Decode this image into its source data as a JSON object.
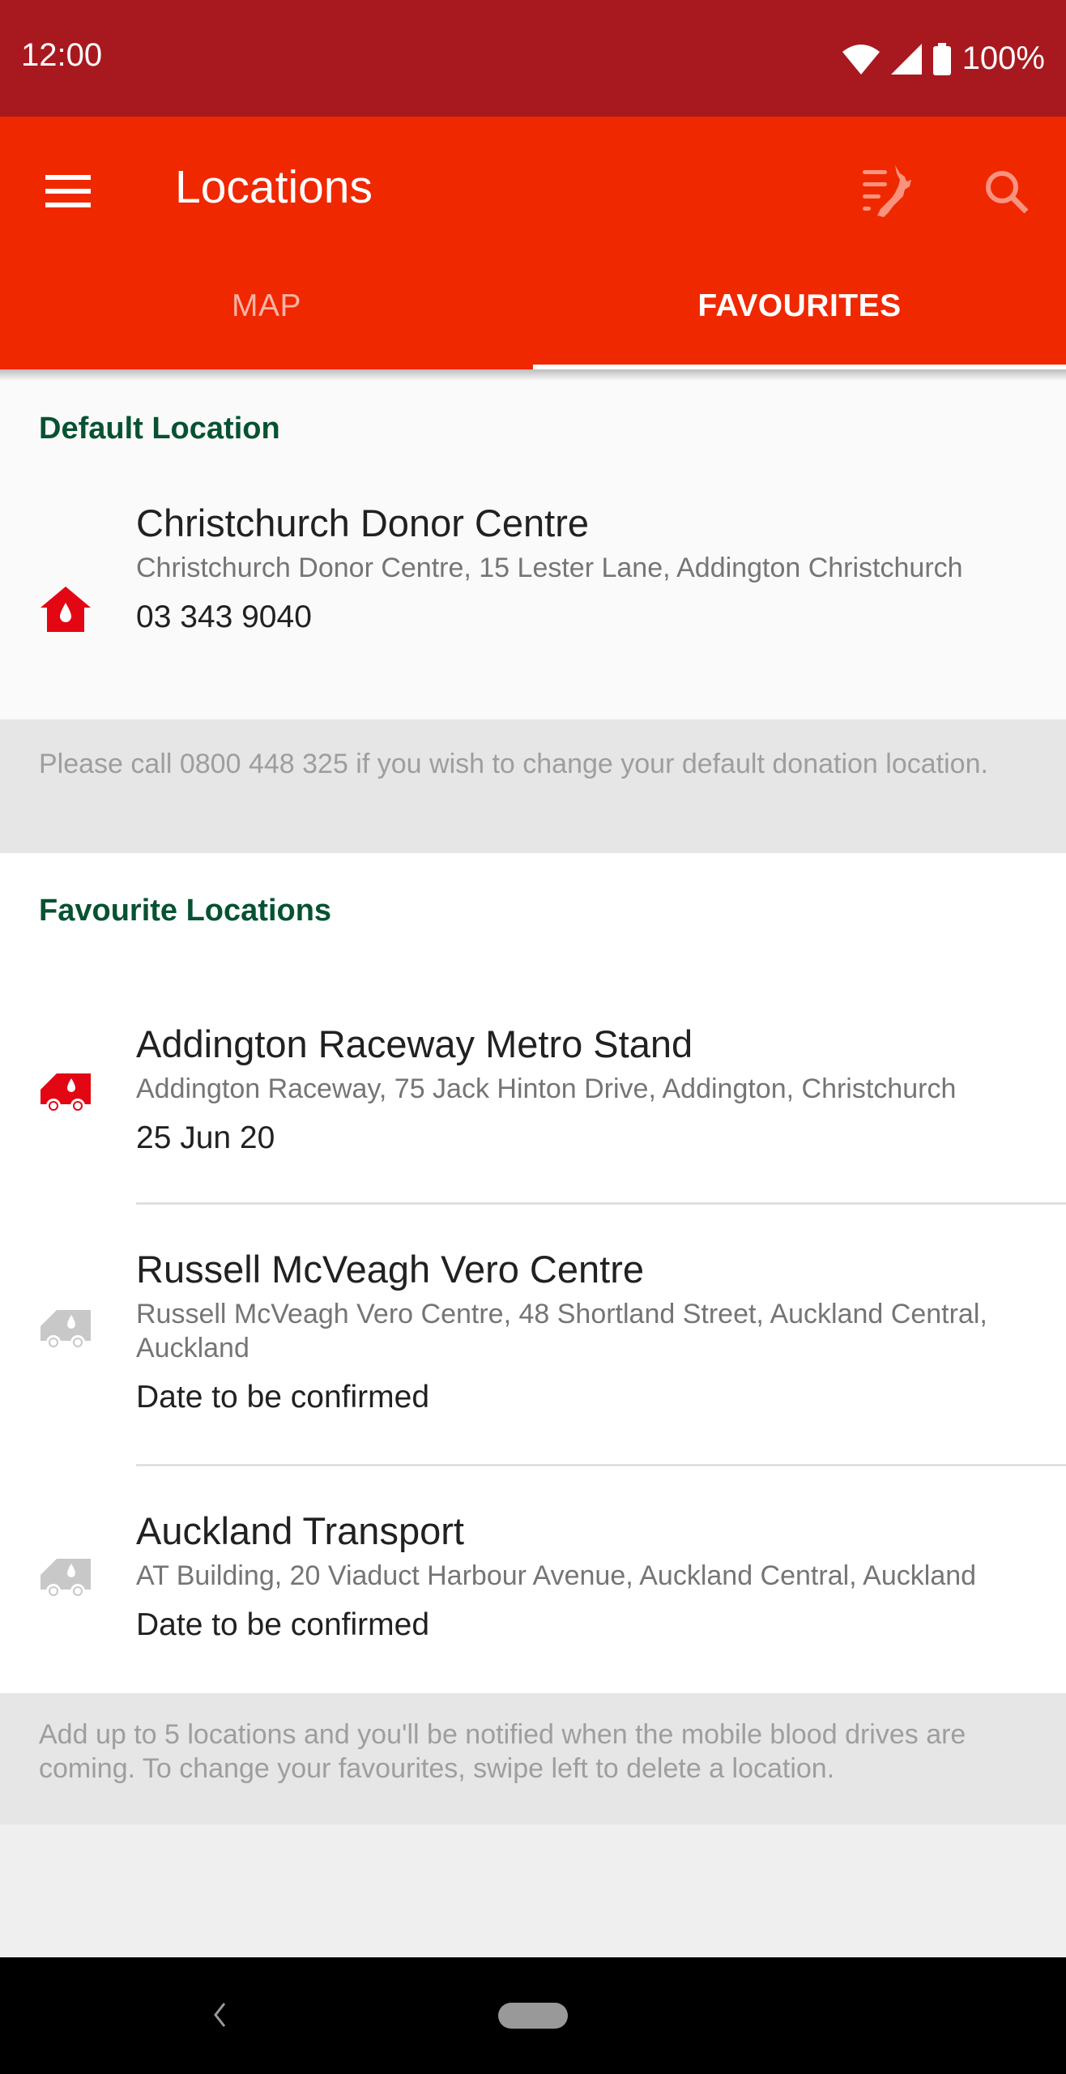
{
  "status_bar": {
    "time": "12:00",
    "battery_percent": "100%",
    "icons": [
      "wifi-icon",
      "cell-signal-icon",
      "battery-icon"
    ]
  },
  "app_bar": {
    "title": "Locations",
    "menu_icon": "hamburger-menu-icon",
    "actions": [
      {
        "name": "nz-region-filter",
        "icon": "nz-map-list-icon"
      },
      {
        "name": "search",
        "icon": "search-icon"
      }
    ]
  },
  "tabs": [
    {
      "label": "MAP",
      "active": false
    },
    {
      "label": "FAVOURITES",
      "active": true
    }
  ],
  "default_section": {
    "header": "Default Location",
    "item": {
      "icon": "donor-centre-house-icon",
      "title": "Christchurch Donor Centre",
      "address": "Christchurch Donor Centre, 15 Lester Lane, Addington Christchurch",
      "phone": "03 343 9040"
    },
    "note": "Please call 0800 448 325 if you wish to change your default donation location."
  },
  "favourites_section": {
    "header": "Favourite Locations",
    "items": [
      {
        "icon": "mobile-blood-drive-van-icon",
        "icon_active": true,
        "title": "Addington Raceway Metro Stand",
        "address": "Addington Raceway, 75 Jack Hinton Drive, Addington, Christchurch",
        "date": "25 Jun 20"
      },
      {
        "icon": "mobile-blood-drive-van-icon",
        "icon_active": false,
        "title": "Russell McVeagh Vero Centre",
        "address": "Russell McVeagh Vero Centre, 48 Shortland Street, Auckland Central, Auckland",
        "date": "Date to be confirmed"
      },
      {
        "icon": "mobile-blood-drive-van-icon",
        "icon_active": false,
        "title": "Auckland Transport",
        "address": "AT Building, 20 Viaduct Harbour Avenue, Auckland Central, Auckland",
        "date": "Date to be confirmed"
      }
    ],
    "note": "Add up to 5 locations and you'll be notified when the mobile blood drives are coming. To change your favourites, swipe left to delete a location."
  },
  "colors": {
    "status_bar": "#A8191F",
    "app_bar": "#F02800",
    "section_header": "#065232",
    "icon_active": "#E30613",
    "icon_inactive": "#C8C8C8",
    "note_bg": "#E6E6E6"
  },
  "nav_bar": {
    "back_icon": "back-chevron-icon",
    "home_icon": "home-pill-icon"
  }
}
